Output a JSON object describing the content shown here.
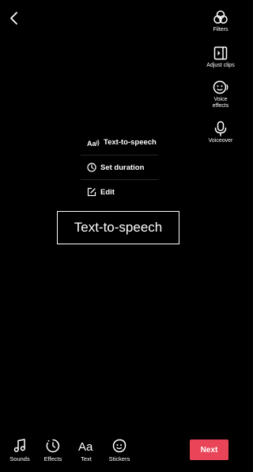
{
  "right_tools": [
    {
      "label": "Filters",
      "icon": "filters-icon"
    },
    {
      "label": "Adjust clips",
      "icon": "adjust-clips-icon"
    },
    {
      "label": "Voice effects",
      "icon": "voice-effects-icon"
    },
    {
      "label": "Voiceover",
      "icon": "voiceover-icon"
    }
  ],
  "menu": [
    {
      "label": "Text-to-speech",
      "icon": "text-to-speech-icon"
    },
    {
      "label": "Set duration",
      "icon": "clock-icon"
    },
    {
      "label": "Edit",
      "icon": "edit-icon"
    }
  ],
  "text_overlay": "Text-to-speech",
  "bottom_tools": [
    {
      "label": "Sounds",
      "icon": "music-note-icon"
    },
    {
      "label": "Effects",
      "icon": "effects-icon"
    },
    {
      "label": "Text",
      "icon": "text-icon",
      "glyph": "Aa"
    },
    {
      "label": "Stickers",
      "icon": "sticker-icon"
    }
  ],
  "next_label": "Next",
  "colors": {
    "background": "#000000",
    "accent": "#ea4459",
    "foreground": "#ffffff"
  }
}
